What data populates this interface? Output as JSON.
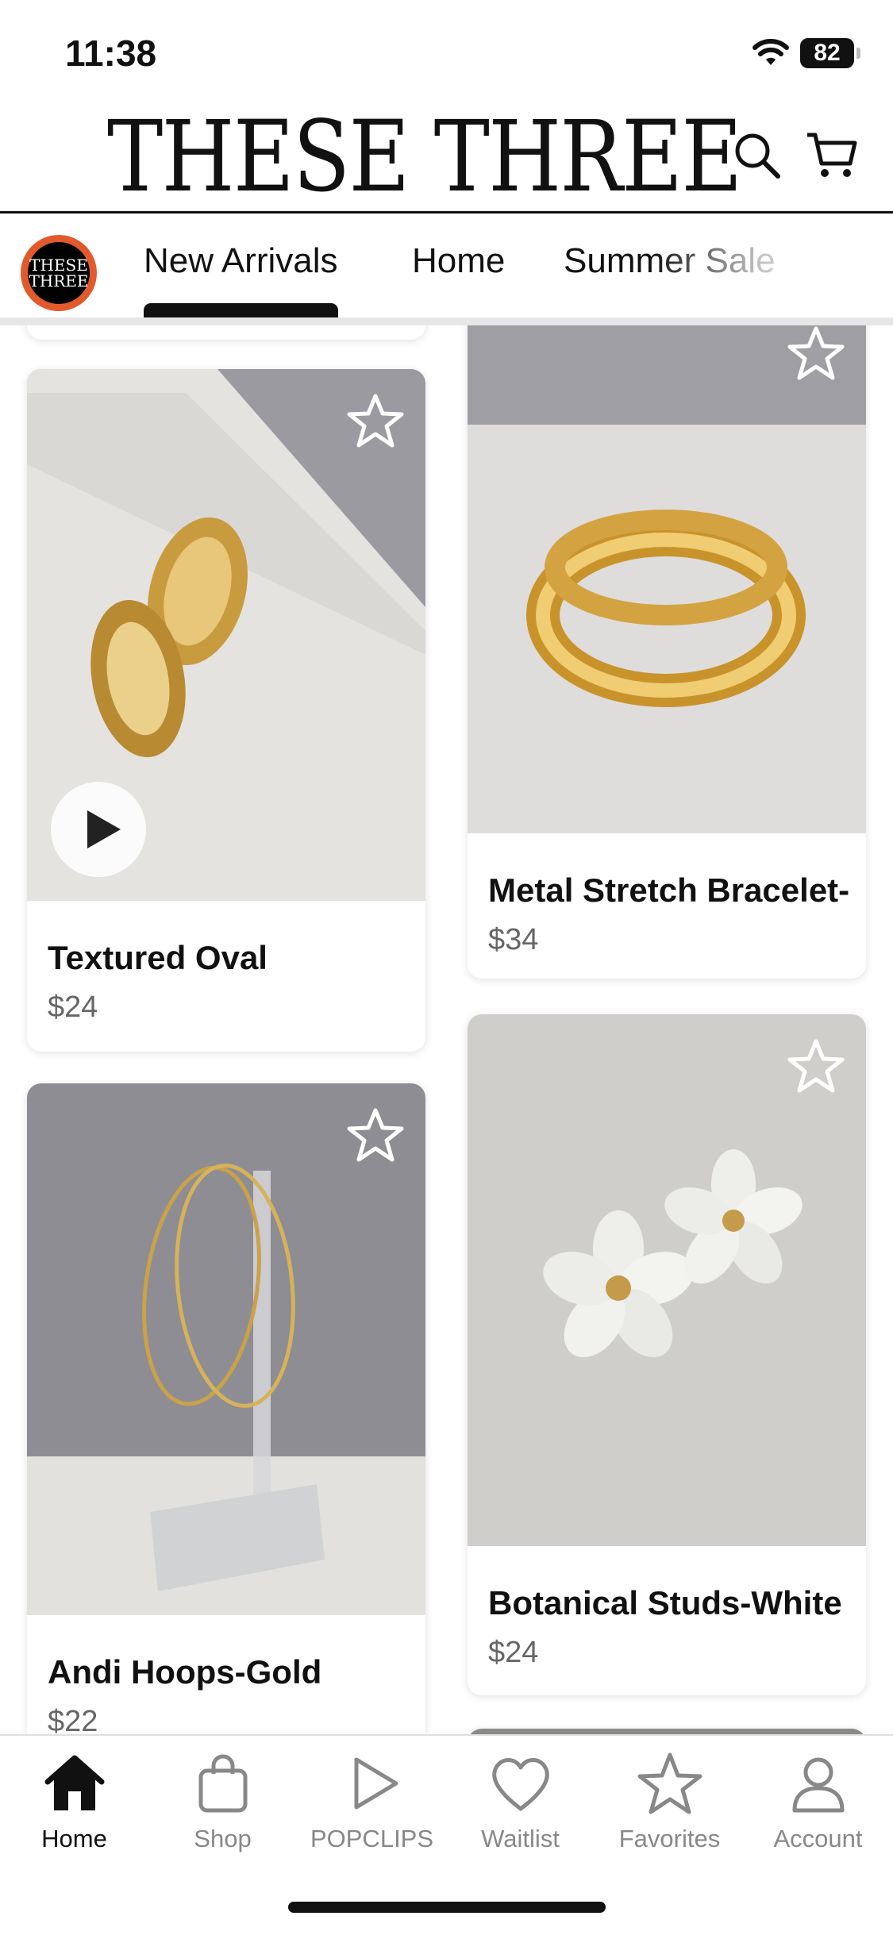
{
  "status": {
    "time": "11:38",
    "battery": "82"
  },
  "header": {
    "brand": "THESE THREE"
  },
  "tabs": {
    "logo_text": "THESE THREE",
    "items": [
      {
        "label": "New Arrivals"
      },
      {
        "label": "Home"
      },
      {
        "label": "Summer Sale"
      }
    ]
  },
  "products": [
    {
      "title": "Textured Oval",
      "price": "$24"
    },
    {
      "title": "Metal Stretch Bracelet-",
      "price": "$34"
    },
    {
      "title": "Andi Hoops-Gold",
      "price": "$22"
    },
    {
      "title": "Botanical Studs-White",
      "price": "$24"
    }
  ],
  "tabbar": {
    "items": [
      {
        "label": "Home"
      },
      {
        "label": "Shop"
      },
      {
        "label": "POPCLIPS"
      },
      {
        "label": "Waitlist"
      },
      {
        "label": "Favorites"
      },
      {
        "label": "Account"
      }
    ]
  }
}
